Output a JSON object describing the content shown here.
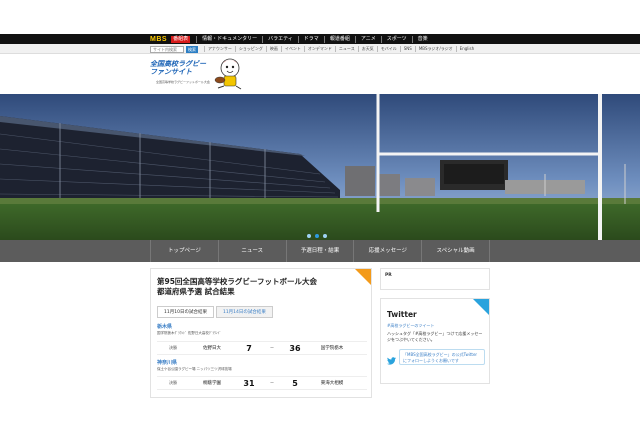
{
  "topbar": {
    "logo": "MBS",
    "badge": "番組表",
    "items": [
      "情報・ドキュメンタリー",
      "バラエティ",
      "ドラマ",
      "報道番組",
      "アニメ",
      "スポーツ",
      "音楽"
    ]
  },
  "subbar": {
    "search_placeholder": "サイト内検索",
    "search_button": "検索",
    "items": [
      "アナウンサー",
      "ショッピング",
      "映画",
      "イベント",
      "オンデマンド",
      "ニュース",
      "お天気",
      "モバイル",
      "SNS",
      "MBSラジオ/ラジオ",
      "English"
    ]
  },
  "logo": {
    "title_line1": "全国高校ラグビー",
    "title_line2": "ファンサイト",
    "sub": "全国高等学校ラグビーフットボール大会"
  },
  "hero": {
    "slides": 3,
    "active_slide": 2
  },
  "menu": {
    "items": [
      "トップページ",
      "ニュース",
      "予選日程・結果",
      "応援メッセージ",
      "スペシャル動画"
    ]
  },
  "results": {
    "title_line1": "第95回全国高等学校ラグビーフットボール大会",
    "title_line2": "都道府県予選 試合結果",
    "tabs": [
      "11月10日の試合結果",
      "11月14日の試合結果"
    ],
    "sections": [
      {
        "region": "栃木県",
        "venue": "国学院栃木ｸﾞﾗｳﾝﾄﾞ 佐野日大高校ｸﾞﾗｳﾝﾄﾞ",
        "round": "決勝",
        "team1": "佐野日大",
        "score1": "7",
        "dash": "ー",
        "score2": "36",
        "team2": "国学院栃木"
      },
      {
        "region": "神奈川県",
        "venue": "保土ケ谷公園ラグビー場 ニッパツ三ツ沢球技場",
        "round": "決勝",
        "team1": "桐蔭学園",
        "score1": "31",
        "dash": "ー",
        "score2": "5",
        "team2": "東海大相模"
      }
    ]
  },
  "sidebar": {
    "pr_label": "PR",
    "twitter": {
      "title": "Twitter",
      "link": "#高校ラグビーのツイート",
      "text": "ハッシュタグ「#高校ラグビー」つけて応援メッセージをつぶやいてください。",
      "follow": "「MBS全国高校ラグビー」の公式Twitterにフォローしようくお願いです"
    }
  }
}
